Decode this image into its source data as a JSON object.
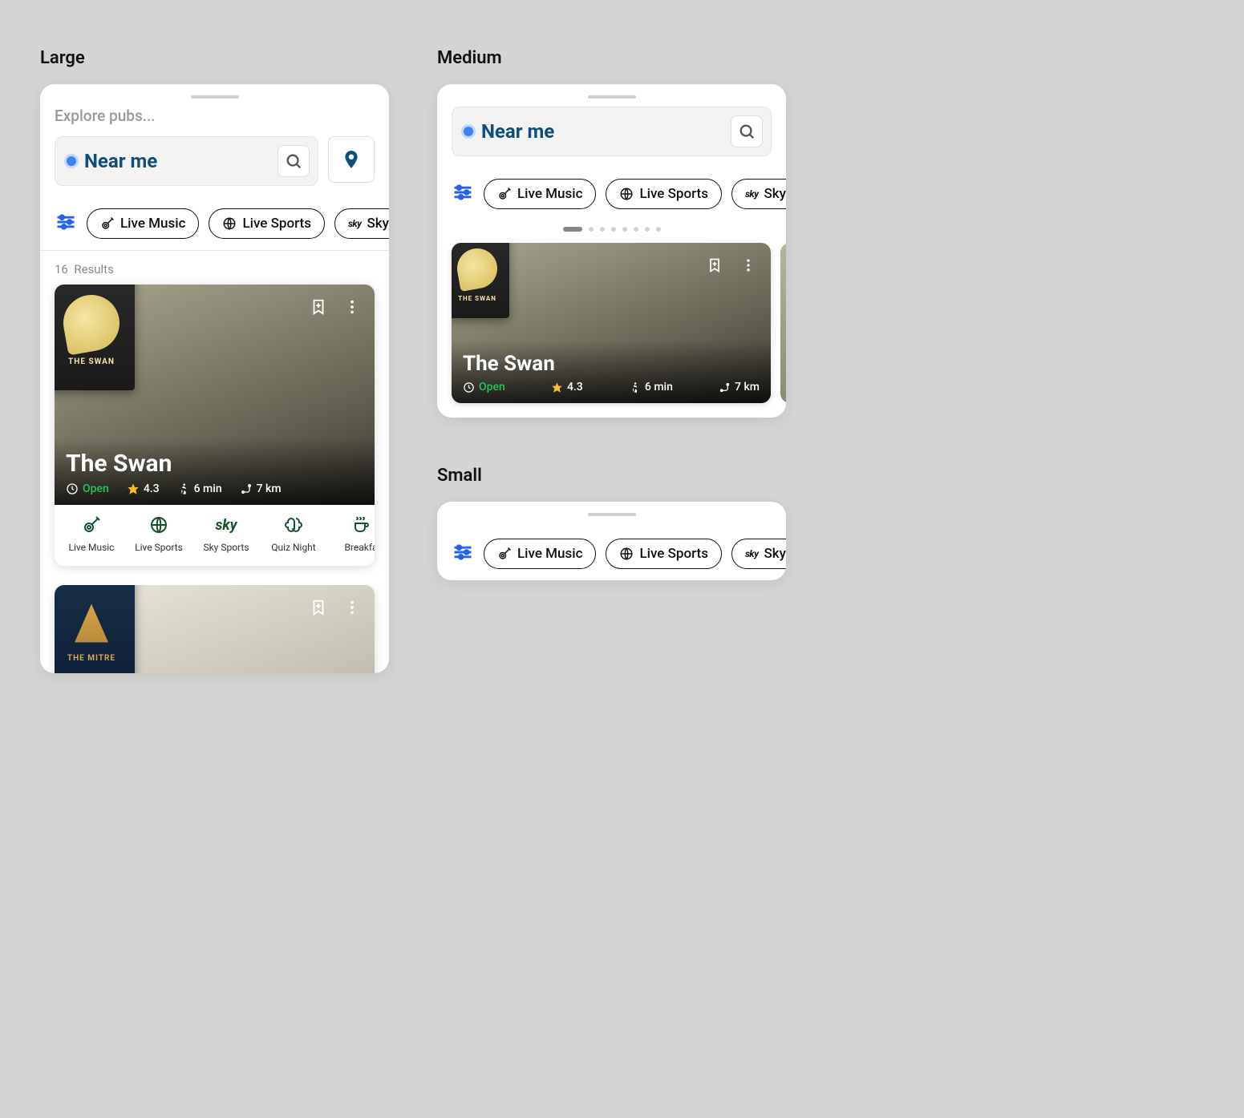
{
  "variants": {
    "large": "Large",
    "medium": "Medium",
    "small": "Small"
  },
  "explore_label": "Explore pubs...",
  "search_text": "Near me",
  "chips": {
    "live_music": "Live Music",
    "live_sports": "Live Sports",
    "sky_sports": "Sky Sports",
    "sky_sports_truncated_l": "Sky S",
    "sky_sports_truncated_m": "Sky S"
  },
  "results": {
    "count": "16",
    "label": "Results"
  },
  "pub": {
    "name": "The Swan",
    "badge": "THE SWAN",
    "status": "Open",
    "rating": "4.3",
    "walk": "6 min",
    "distance": "7 km"
  },
  "amenities": {
    "live_music": "Live Music",
    "live_sports": "Live Sports",
    "sky_sports": "Sky Sports",
    "quiz_night": "Quiz Night",
    "breakfast": "Breakfa"
  },
  "peek_pub": {
    "badge": "THE MITRE"
  },
  "dots_count": 8,
  "colors": {
    "accent_blue": "#2563eb",
    "brand_text": "#0d4f7a",
    "open_green": "#22c55e",
    "star_yellow": "#fbbf24",
    "amenity_green": "#14532d"
  }
}
